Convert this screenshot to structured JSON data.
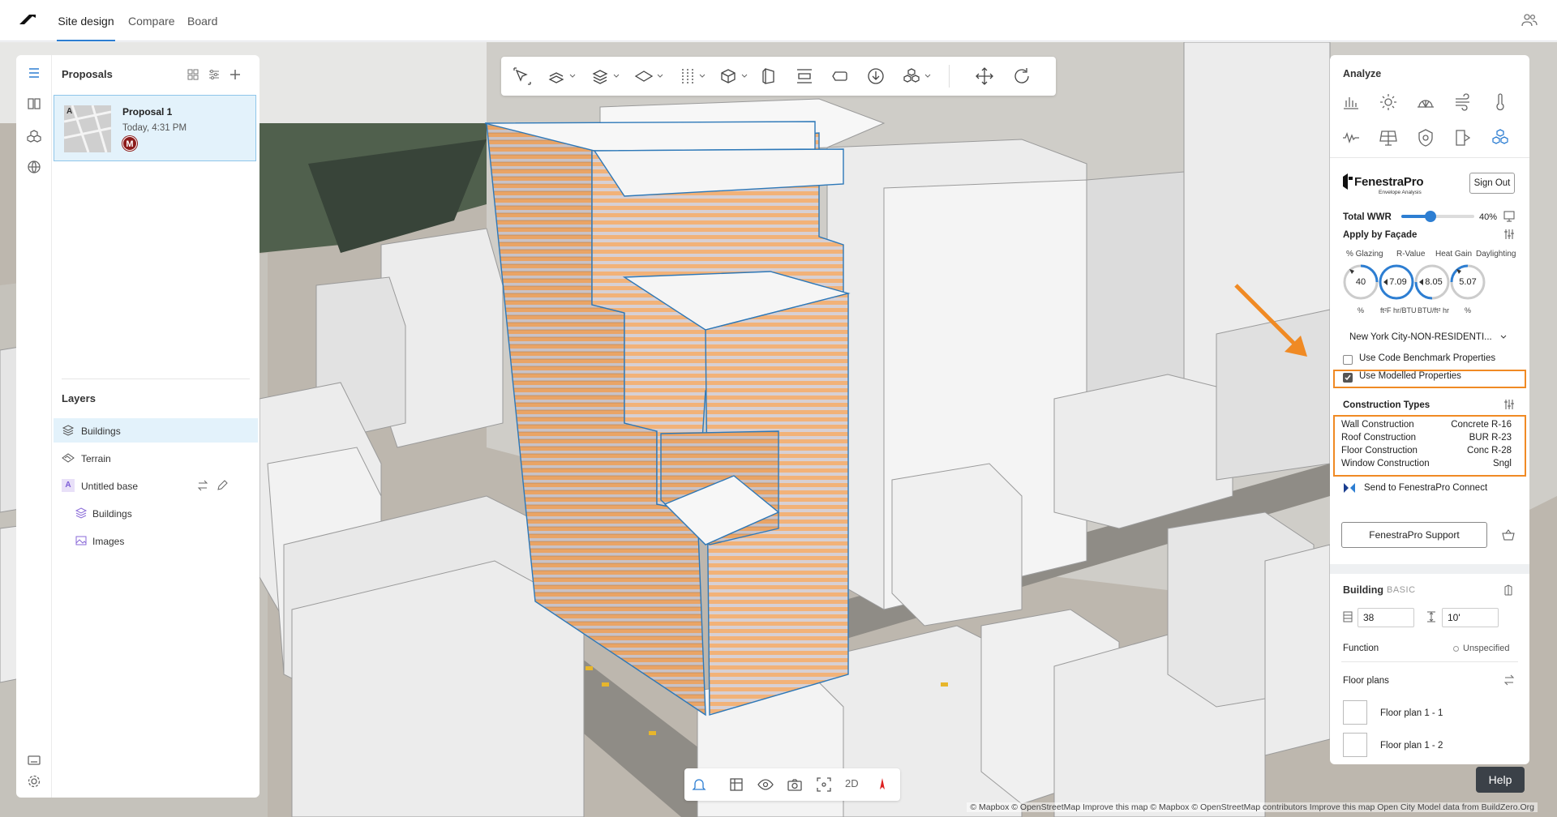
{
  "topbar": {
    "tabs": [
      "Site design",
      "Compare",
      "Board"
    ]
  },
  "proposals": {
    "title": "Proposals",
    "card": {
      "badge": "A",
      "name": "Proposal 1",
      "time": "Today, 4:31 PM",
      "avatar": "M"
    }
  },
  "layers": {
    "title": "Layers",
    "items": [
      {
        "label": "Buildings",
        "icon": "layers-icon"
      },
      {
        "label": "Terrain",
        "icon": "terrain-icon"
      },
      {
        "label": "Untitled base",
        "icon": "base-icon",
        "badge": "A"
      },
      {
        "label": "Buildings",
        "icon": "buildings-icon"
      },
      {
        "label": "Images",
        "icon": "image-icon"
      }
    ]
  },
  "toolbar": {
    "icons": [
      "select-icon",
      "draw-building-icon",
      "stack-icon",
      "plane-icon",
      "split-icon",
      "box-icon",
      "cube-icon",
      "align-icon",
      "tag-icon",
      "download-icon",
      "components-icon",
      "move-icon",
      "rotate-icon"
    ]
  },
  "bottombar": {
    "mode_label": "2D"
  },
  "analyze": {
    "title": "Analyze",
    "icons": [
      "chart-icon",
      "sun-icon",
      "dome-icon",
      "wind-icon",
      "thermometer-icon",
      "noise-icon",
      "solar-panel-icon",
      "shield-icon",
      "daylight-icon",
      "fenestra-icon"
    ]
  },
  "fenestra": {
    "name": "FenestraPro",
    "subtitle": "Envelope Analysis",
    "sign_out": "Sign Out",
    "total_wwr_label": "Total WWR",
    "total_wwr_value": "40%",
    "total_wwr_fraction": 0.4,
    "apply_by_facade": "Apply by Façade",
    "metrics": [
      {
        "label": "% Glazing",
        "value": "40",
        "unit": "%"
      },
      {
        "label": "R-Value",
        "value": "7.09",
        "unit": "ft²F hr/BTU"
      },
      {
        "label": "Heat Gain",
        "value": "8.05",
        "unit": "BTU/ft² hr"
      },
      {
        "label": "Daylighting",
        "value": "5.07",
        "unit": "%"
      }
    ],
    "benchmark_select": "New York City-NON-RESIDENTI...",
    "use_code_benchmark": "Use Code Benchmark Properties",
    "use_modelled": "Use Modelled Properties",
    "construction_types_title": "Construction Types",
    "construction_types": [
      {
        "label": "Wall Construction",
        "value": "Concrete R-16"
      },
      {
        "label": "Roof Construction",
        "value": "BUR R-23"
      },
      {
        "label": "Floor Construction",
        "value": "Conc R-28"
      },
      {
        "label": "Window Construction",
        "value": "Sngl"
      }
    ],
    "send_label": "Send to FenestraPro Connect",
    "support_label": "FenestraPro Support"
  },
  "building": {
    "title": "Building",
    "tag": "BASIC",
    "floors": "38",
    "floor_height": "10'",
    "function_label": "Function",
    "function_value": "Unspecified",
    "floor_plans_title": "Floor plans",
    "floor_plans": [
      "Floor plan 1 - 1",
      "Floor plan 1 - 2"
    ]
  },
  "map": {
    "attribution": "© Mapbox © OpenStreetMap  Improve this map © Mapbox © OpenStreetMap contributors  Improve this map  Open City Model data from BuildZero.Org",
    "help": "Help"
  },
  "colors": {
    "accent": "#2d7ed2",
    "highlight": "#f08a24",
    "facade": "#e8a063"
  }
}
